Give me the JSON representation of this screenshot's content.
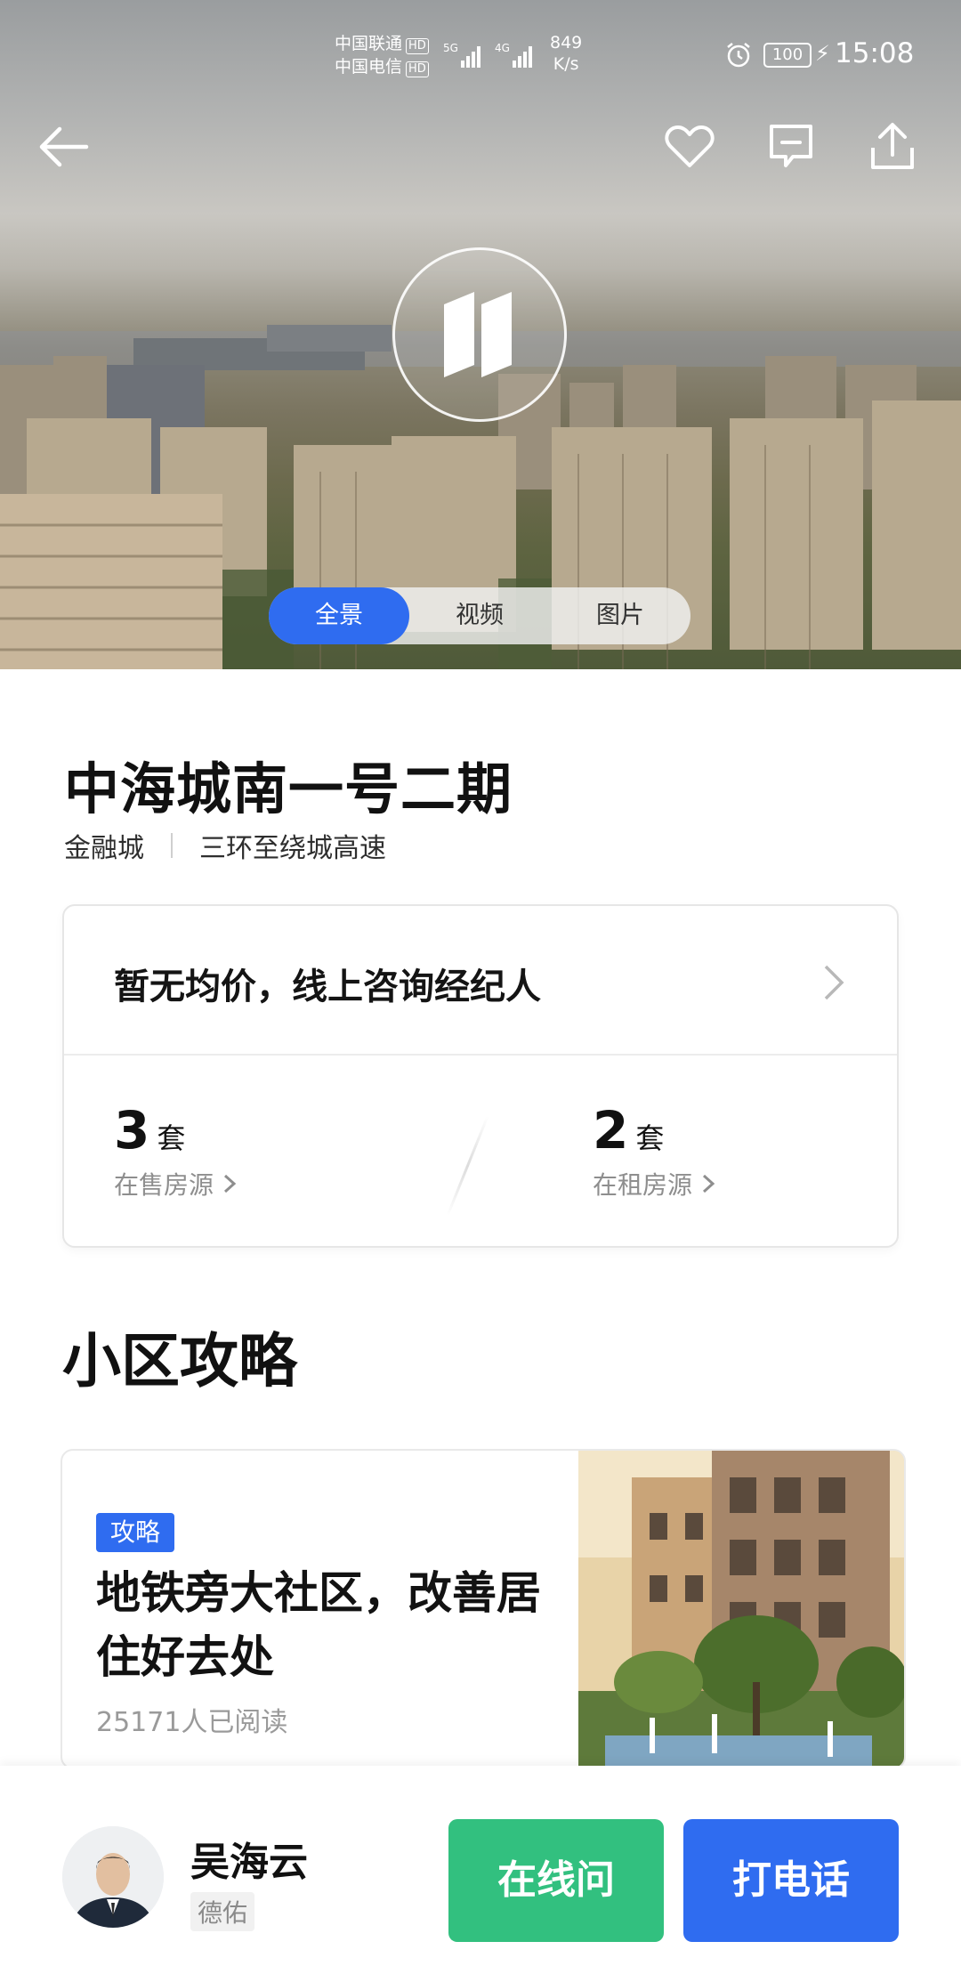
{
  "status_bar": {
    "carrier1": "中国联通",
    "carrier2": "中国电信",
    "hd": "HD",
    "net1": "5G",
    "net2": "4G",
    "speed_value": "849",
    "speed_unit": "K/s",
    "battery": "100",
    "time": "15:08"
  },
  "media_tabs": [
    "全景",
    "视频",
    "图片"
  ],
  "active_media_tab": 0,
  "property": {
    "title": "中海城南一号二期",
    "district": "金融城",
    "ring_area": "三环至绕城高速"
  },
  "price_card": {
    "price_text": "暂无均价，线上咨询经纪人",
    "for_sale_count": "3",
    "for_sale_unit": "套",
    "for_sale_label": "在售房源",
    "for_rent_count": "2",
    "for_rent_unit": "套",
    "for_rent_label": "在租房源"
  },
  "guide": {
    "section_title": "小区攻略",
    "tag": "攻略",
    "article_title": "地铁旁大社区，改善居住好去处",
    "reads": "25171人已阅读"
  },
  "agent": {
    "name": "吴海云",
    "company": "德佑"
  },
  "actions": {
    "chat_label": "在线问",
    "call_label": "打电话"
  },
  "colors": {
    "primary_blue": "#2f6cf0",
    "chat_green": "#32c07f"
  }
}
